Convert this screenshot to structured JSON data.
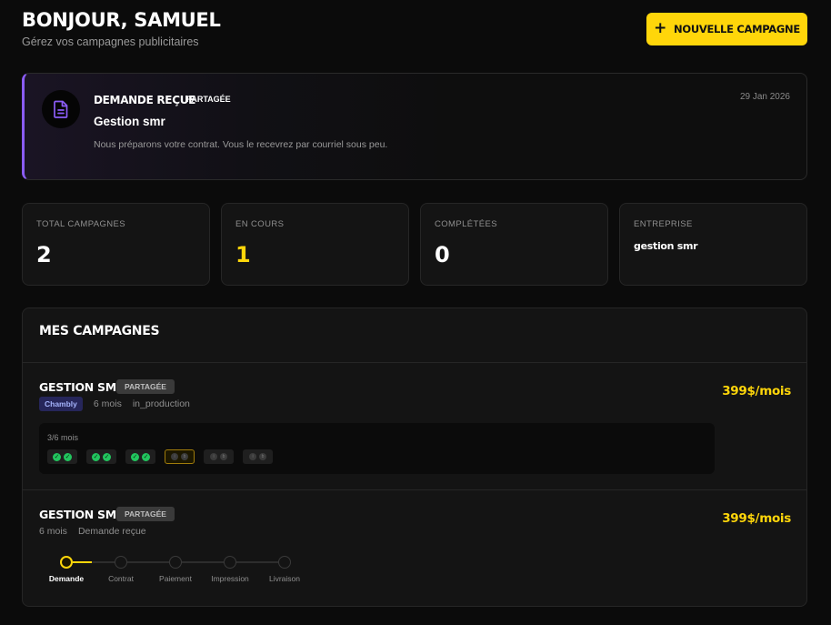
{
  "header": {
    "greeting": "BONJOUR, SAMUEL",
    "subtitle": "Gérez vos campagnes publicitaires",
    "new_button_label": "NOUVELLE CAMPAGNE"
  },
  "notification": {
    "title": "DEMANDE REÇUE",
    "tag": "PARTAGÉE",
    "date": "29 Jan 2026",
    "name": "Gestion smr",
    "message": "Nous préparons votre contrat. Vous le recevrez par courriel sous peu.",
    "accent_color": "#8b5cf6",
    "icon": "document-icon"
  },
  "stats": {
    "total": {
      "label": "TOTAL CAMPAGNES",
      "value": "2"
    },
    "in_progress": {
      "label": "EN COURS",
      "value": "1"
    },
    "completed": {
      "label": "COMPLÉTÉES",
      "value": "0"
    },
    "company": {
      "label": "ENTREPRISE",
      "value": "gestion smr"
    }
  },
  "campaigns_section": {
    "title": "MES CAMPAGNES",
    "items": [
      {
        "name": "GESTION SMR",
        "tag": "PARTAGÉE",
        "price": "399$/mois",
        "location": "Chambly",
        "duration": "6 mois",
        "status": "in_production",
        "progress_label": "3/6 mois",
        "months_done": 3,
        "months_total": 6
      },
      {
        "name": "GESTION SMR",
        "tag": "PARTAGÉE",
        "price": "399$/mois",
        "duration": "6 mois",
        "status": "Demande reçue",
        "steps": [
          "Demande",
          "Contrat",
          "Paiement",
          "Impression",
          "Livraison"
        ],
        "current_step": 0
      }
    ]
  },
  "colors": {
    "accent": "#ffd60a",
    "success": "#22c55e",
    "background": "#0b0b0b",
    "card": "#141414"
  }
}
